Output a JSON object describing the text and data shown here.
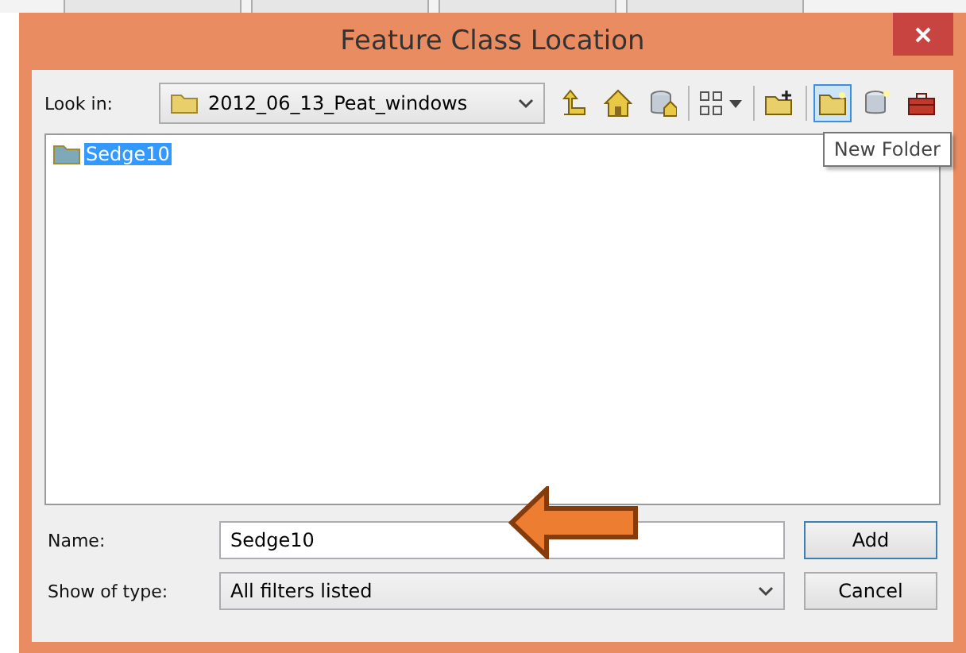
{
  "window": {
    "title": "Feature Class Location"
  },
  "look_in": {
    "label": "Look in:",
    "value": "2012_06_13_Peat_windows"
  },
  "toolbar": [
    {
      "kind": "up",
      "selected": false
    },
    {
      "kind": "home",
      "selected": false
    },
    {
      "kind": "dbhome",
      "selected": false
    },
    {
      "kind": "sep"
    },
    {
      "kind": "grid",
      "selected": false
    },
    {
      "kind": "sep"
    },
    {
      "kind": "connect",
      "selected": false
    },
    {
      "kind": "sep"
    },
    {
      "kind": "folder",
      "selected": true
    },
    {
      "kind": "db",
      "selected": false
    },
    {
      "kind": "toolbox",
      "selected": false
    }
  ],
  "tooltip": "New Folder",
  "files": [
    {
      "name": "Sedge10",
      "selected": true
    }
  ],
  "name_field": {
    "label": "Name:",
    "value": "Sedge10"
  },
  "type_field": {
    "label": "Show of type:",
    "value": "All filters listed"
  },
  "buttons": [
    {
      "label": "Add",
      "default": true
    },
    {
      "label": "Cancel",
      "default": false
    }
  ]
}
